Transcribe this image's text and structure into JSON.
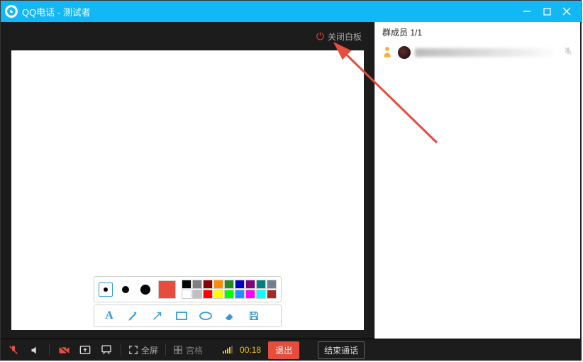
{
  "window": {
    "app_name": "QQ电话",
    "separator": " - ",
    "session_name": "测试者"
  },
  "whiteboard": {
    "close_label": "关闭白板"
  },
  "palette": {
    "selected_size_index": 0,
    "selected_color": "#e74c3c",
    "row1": [
      "#000000",
      "#808080",
      "#8b0000",
      "#ff8c00",
      "#228b22",
      "#0000cd",
      "#800080",
      "#008080",
      "#708090"
    ],
    "row2": [
      "#ffffff",
      "#c0c0c0",
      "#ff0000",
      "#ffff00",
      "#00ff00",
      "#1e90ff",
      "#ff00ff",
      "#00ffff",
      "#a52a2a"
    ]
  },
  "tools": {
    "text": "A",
    "pen": "pen",
    "arrow": "arrow",
    "rect": "rect",
    "ellipse": "ellipse",
    "eraser": "eraser",
    "save": "save"
  },
  "members": {
    "header": "群成员 1/1",
    "list": [
      {
        "name": "▇▇"
      }
    ]
  },
  "bottombar": {
    "fullscreen": "全屏",
    "grid": "宫格",
    "timer": "00:18",
    "exit": "退出",
    "end_call": "结束通话"
  }
}
